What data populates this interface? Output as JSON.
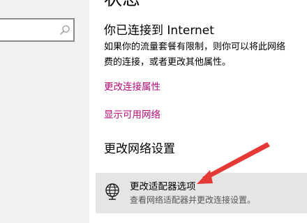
{
  "header": {
    "title": "状态"
  },
  "sidebar": {
    "search": {
      "value": "",
      "placeholder": "",
      "icon": "search-icon"
    }
  },
  "status": {
    "title": "你已连接到 Internet",
    "description_line1": "如果你的流量套餐有限制，则你可以将此网络",
    "description_line2": "费的连接，或者更改其他属性。"
  },
  "links": {
    "change_connection_properties": "更改连接属性",
    "show_available_networks": "显示可用网络"
  },
  "network_settings": {
    "section_title": "更改网络设置",
    "adapter_options": {
      "title": "更改适配器选项",
      "description": "查看网络适配器并更改连接设置。",
      "icon": "globe-network-icon"
    }
  },
  "colors": {
    "link": "#b40a78",
    "annotation_arrow": "#e53935",
    "highlight_row": "#e5e5e5"
  }
}
